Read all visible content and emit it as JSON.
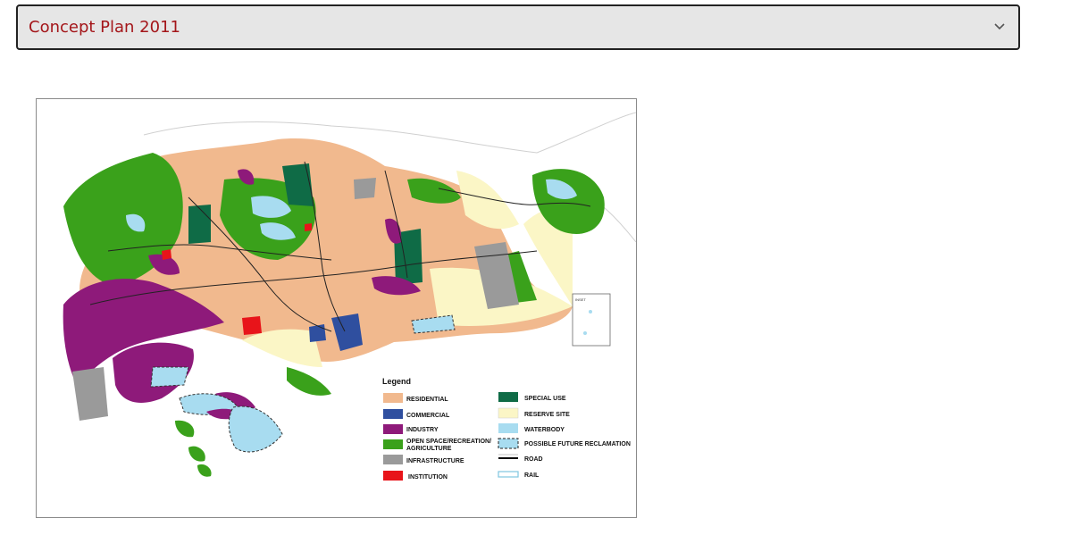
{
  "dropdown": {
    "selected": "Concept Plan 2011",
    "icon": "chevron-down-icon"
  },
  "map": {
    "inset_label": "INSET",
    "legend": {
      "title": "Legend",
      "items": [
        {
          "label": "RESIDENTIAL",
          "color": "#f1b98e",
          "kind": "fill"
        },
        {
          "label": "COMMERCIAL",
          "color": "#2f4f9f",
          "kind": "fill"
        },
        {
          "label": "INDUSTRY",
          "color": "#8e1a7a",
          "kind": "fill"
        },
        {
          "label": "OPEN SPACE/RECREATION/",
          "label2": "AGRICULTURE",
          "color": "#3aa11b",
          "kind": "fill"
        },
        {
          "label": "INFRASTRUCTURE",
          "color": "#9a9a9a",
          "kind": "fill"
        },
        {
          "label": "INSTITUTION",
          "color": "#e8141a",
          "kind": "fill"
        },
        {
          "label": "SPECIAL USE",
          "color": "#0f6b46",
          "kind": "fill"
        },
        {
          "label": "RESERVE SITE",
          "color": "#fbf6c6",
          "kind": "fill"
        },
        {
          "label": "WATERBODY",
          "color": "#a8dcf0",
          "kind": "fill"
        },
        {
          "label": "POSSIBLE FUTURE RECLAMATION",
          "color": "#a8dcf0",
          "kind": "dashed"
        },
        {
          "label": "ROAD",
          "color": "#000000",
          "kind": "road"
        },
        {
          "label": "RAIL",
          "color": "#7fc6e0",
          "kind": "rail"
        }
      ]
    }
  }
}
